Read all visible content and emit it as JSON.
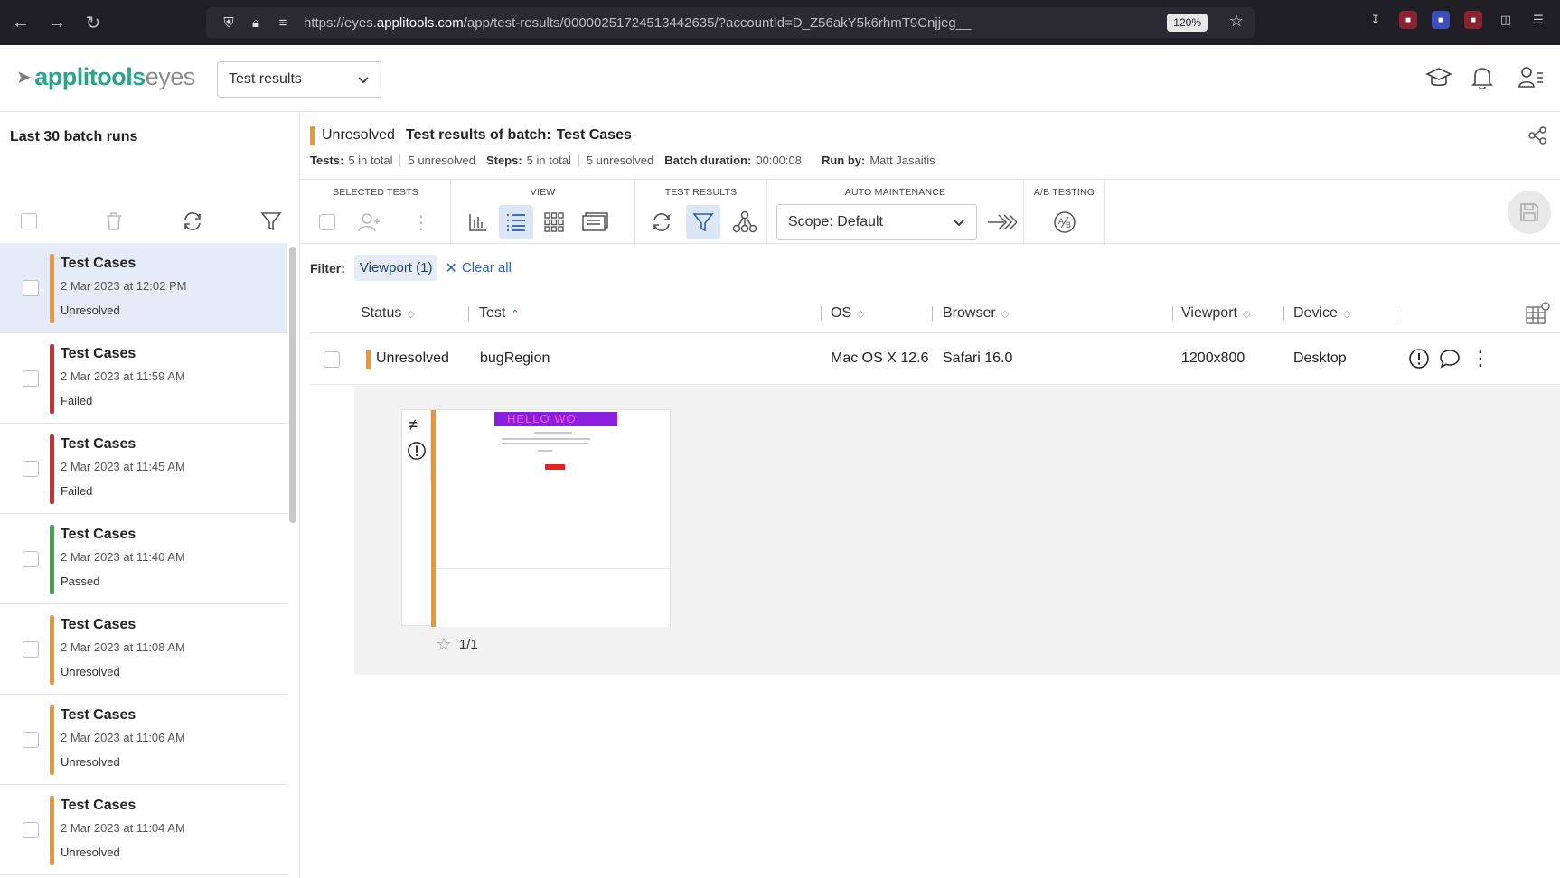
{
  "browser": {
    "url_prefix": "https://eyes.",
    "url_domain": "applitools.com",
    "url_rest": "/app/test-results/00000251724513442635/?accountId=D_Z56akY5k6rhmT9Cnjjeg__",
    "zoom": "120%"
  },
  "header": {
    "logo_part1": "applitools",
    "logo_part2": "eyes",
    "view_select": "Test results"
  },
  "sidebar": {
    "title": "Last 30 batch runs",
    "batches": [
      {
        "name": "Test Cases",
        "date": "2 Mar 2023 at 12:02 PM",
        "status": "Unresolved",
        "color": "#f0962e",
        "selected": true
      },
      {
        "name": "Test Cases",
        "date": "2 Mar 2023 at 11:59 AM",
        "status": "Failed",
        "color": "#d92b2b",
        "selected": false
      },
      {
        "name": "Test Cases",
        "date": "2 Mar 2023 at 11:45 AM",
        "status": "Failed",
        "color": "#d92b2b",
        "selected": false
      },
      {
        "name": "Test Cases",
        "date": "2 Mar 2023 at 11:40 AM",
        "status": "Passed",
        "color": "#3aa84b",
        "selected": false
      },
      {
        "name": "Test Cases",
        "date": "2 Mar 2023 at 11:08 AM",
        "status": "Unresolved",
        "color": "#f0962e",
        "selected": false
      },
      {
        "name": "Test Cases",
        "date": "2 Mar 2023 at 11:06 AM",
        "status": "Unresolved",
        "color": "#f0962e",
        "selected": false
      },
      {
        "name": "Test Cases",
        "date": "2 Mar 2023 at 11:04 AM",
        "status": "Unresolved",
        "color": "#f0962e",
        "selected": false
      }
    ]
  },
  "batch": {
    "status": "Unresolved",
    "title_label": "Test results of batch:",
    "title": "Test Cases",
    "meta": {
      "tests_label": "Tests:",
      "tests_total": "5 in total",
      "tests_unresolved": "5 unresolved",
      "steps_label": "Steps:",
      "steps_total": "5 in total",
      "steps_unresolved": "5 unresolved",
      "duration_label": "Batch duration:",
      "duration": "00:00:08",
      "runby_label": "Run by:",
      "runby": "Matt Jasaitis"
    }
  },
  "toolbar": {
    "selected_tests": "SELECTED TESTS",
    "view": "VIEW",
    "test_results": "TEST RESULTS",
    "auto_maintenance": "AUTO MAINTENANCE",
    "ab_testing": "A/B TESTING",
    "scope": "Scope: Default"
  },
  "filter": {
    "label": "Filter:",
    "chip": "Viewport (1)",
    "clear": "Clear all"
  },
  "table": {
    "columns": [
      "Status",
      "Test",
      "OS",
      "Browser",
      "Viewport",
      "Device"
    ],
    "row": {
      "status": "Unresolved",
      "test": "bugRegion",
      "os": "Mac OS X 12.6",
      "browser": "Safari 16.0",
      "viewport": "1200x800",
      "device": "Desktop"
    }
  },
  "thumbnail": {
    "banner_text": "HELLO WO",
    "step_count": "1/1"
  }
}
